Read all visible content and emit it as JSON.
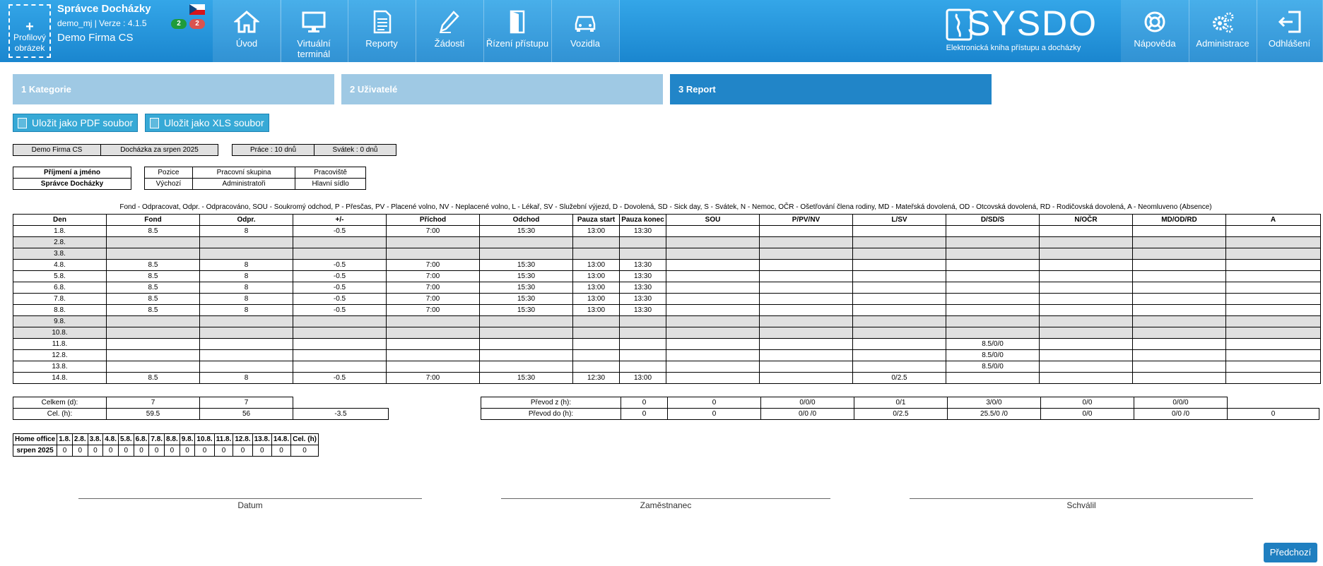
{
  "header": {
    "profile_label": "Profilový obrázek",
    "profile_plus": "+",
    "app_title": "Správce Docházky",
    "user_version": "demo_mj | Verze : 4.1.5",
    "company": "Demo Firma CS",
    "badge_green": "2",
    "badge_red": "2",
    "nav": [
      {
        "label": "Úvod",
        "icon": "home-icon"
      },
      {
        "label": "Virtuální terminál",
        "icon": "monitor-icon"
      },
      {
        "label": "Reporty",
        "icon": "document-icon"
      },
      {
        "label": "Žádosti",
        "icon": "pen-icon"
      },
      {
        "label": "Řízení přístupu",
        "icon": "door-icon"
      },
      {
        "label": "Vozidla",
        "icon": "car-icon"
      }
    ],
    "logo_name": "SYSDO",
    "logo_sub": "Elektronická kniha přístupu a docházky",
    "right_nav": [
      {
        "label": "Nápověda",
        "icon": "lifebuoy-icon"
      },
      {
        "label": "Administrace",
        "icon": "gears-icon"
      },
      {
        "label": "Odhlášení",
        "icon": "logout-icon"
      }
    ]
  },
  "steps": [
    "1 Kategorie",
    "2 Uživatelé",
    "3 Report"
  ],
  "buttons": {
    "pdf": "Uložit jako PDF soubor",
    "xls": "Uložit jako XLS soubor",
    "next": "Předchozí"
  },
  "info": {
    "company": "Demo Firma CS",
    "period": "Docházka za srpen 2025",
    "work": "Práce : 10 dnů",
    "holiday": "Svátek : 0 dnů"
  },
  "person": {
    "h_name": "Příjmení a jméno",
    "name": "Správce Docházky",
    "h_pos": "Pozice",
    "pos": "Výchozí",
    "h_group": "Pracovní skupina",
    "group": "Administratoři",
    "h_place": "Pracoviště",
    "place": "Hlavní sídlo"
  },
  "legend": "Fond - Odpracovat, Odpr. - Odpracováno, SOU - Soukromý odchod, P - Přesčas, PV - Placené volno, NV - Neplacené volno, L - Lékař, SV - Služební výjezd, D - Dovolená, SD - Sick day, S - Svátek, N - Nemoc, OČR - Ošetřování člena rodiny, MD - Mateřská dovolená, OD - Otcovská dovolená, RD - Rodičovská dovolená, A - Neomluveno (Absence)",
  "att_headers": [
    "Den",
    "Fond",
    "Odpr.",
    "+/-",
    "Příchod",
    "Odchod",
    "Pauza start",
    "Pauza konec",
    "SOU",
    "P/PV/NV",
    "L/SV",
    "D/SD/S",
    "N/OČR",
    "MD/OD/RD",
    "A"
  ],
  "att_rows": [
    {
      "cells": [
        "1.8.",
        "8.5",
        "8",
        "-0.5",
        "7:00",
        "15:30",
        "13:00",
        "13:30",
        "",
        "",
        "",
        "",
        "",
        "",
        ""
      ],
      "weekend": false
    },
    {
      "cells": [
        "2.8.",
        "",
        "",
        "",
        "",
        "",
        "",
        "",
        "",
        "",
        "",
        "",
        "",
        "",
        ""
      ],
      "weekend": true
    },
    {
      "cells": [
        "3.8.",
        "",
        "",
        "",
        "",
        "",
        "",
        "",
        "",
        "",
        "",
        "",
        "",
        "",
        ""
      ],
      "weekend": true
    },
    {
      "cells": [
        "4.8.",
        "8.5",
        "8",
        "-0.5",
        "7:00",
        "15:30",
        "13:00",
        "13:30",
        "",
        "",
        "",
        "",
        "",
        "",
        ""
      ],
      "weekend": false
    },
    {
      "cells": [
        "5.8.",
        "8.5",
        "8",
        "-0.5",
        "7:00",
        "15:30",
        "13:00",
        "13:30",
        "",
        "",
        "",
        "",
        "",
        "",
        ""
      ],
      "weekend": false
    },
    {
      "cells": [
        "6.8.",
        "8.5",
        "8",
        "-0.5",
        "7:00",
        "15:30",
        "13:00",
        "13:30",
        "",
        "",
        "",
        "",
        "",
        "",
        ""
      ],
      "weekend": false
    },
    {
      "cells": [
        "7.8.",
        "8.5",
        "8",
        "-0.5",
        "7:00",
        "15:30",
        "13:00",
        "13:30",
        "",
        "",
        "",
        "",
        "",
        "",
        ""
      ],
      "weekend": false
    },
    {
      "cells": [
        "8.8.",
        "8.5",
        "8",
        "-0.5",
        "7:00",
        "15:30",
        "13:00",
        "13:30",
        "",
        "",
        "",
        "",
        "",
        "",
        ""
      ],
      "weekend": false
    },
    {
      "cells": [
        "9.8.",
        "",
        "",
        "",
        "",
        "",
        "",
        "",
        "",
        "",
        "",
        "",
        "",
        "",
        ""
      ],
      "weekend": true
    },
    {
      "cells": [
        "10.8.",
        "",
        "",
        "",
        "",
        "",
        "",
        "",
        "",
        "",
        "",
        "",
        "",
        "",
        ""
      ],
      "weekend": true
    },
    {
      "cells": [
        "11.8.",
        "",
        "",
        "",
        "",
        "",
        "",
        "",
        "",
        "",
        "",
        "8.5/0/0",
        "",
        "",
        ""
      ],
      "weekend": false
    },
    {
      "cells": [
        "12.8.",
        "",
        "",
        "",
        "",
        "",
        "",
        "",
        "",
        "",
        "",
        "8.5/0/0",
        "",
        "",
        ""
      ],
      "weekend": false
    },
    {
      "cells": [
        "13.8.",
        "",
        "",
        "",
        "",
        "",
        "",
        "",
        "",
        "",
        "",
        "8.5/0/0",
        "",
        "",
        ""
      ],
      "weekend": false
    },
    {
      "cells": [
        "14.8.",
        "8.5",
        "8",
        "-0.5",
        "7:00",
        "15:30",
        "12:30",
        "13:00",
        "",
        "",
        "0/2.5",
        "",
        "",
        "",
        ""
      ],
      "weekend": false
    }
  ],
  "totals": [
    {
      "label": "Celkem (d):",
      "fond": "7",
      "odpr": "7",
      "diff": ""
    },
    {
      "label": "Cel. (h):",
      "fond": "59.5",
      "odpr": "56",
      "diff": "-3.5"
    }
  ],
  "transfers": [
    {
      "label": "Převod z (h):",
      "values": [
        "0",
        "0",
        "0/0/0",
        "0/1",
        "3/0/0",
        "0/0",
        "0/0/0"
      ]
    },
    {
      "label": "Převod do (h):",
      "values": [
        "0",
        "0",
        "0/0 /0",
        "0/2.5",
        "25.5/0 /0",
        "0/0",
        "0/0 /0",
        "0"
      ]
    }
  ],
  "home_office": {
    "headers": [
      "Home office",
      "1.8.",
      "2.8.",
      "3.8.",
      "4.8.",
      "5.8.",
      "6.8.",
      "7.8.",
      "8.8.",
      "9.8.",
      "10.8.",
      "11.8.",
      "12.8.",
      "13.8.",
      "14.8.",
      "Cel. (h)"
    ],
    "row": [
      "srpen 2025",
      "0",
      "0",
      "0",
      "0",
      "0",
      "0",
      "0",
      "0",
      "0",
      "0",
      "0",
      "0",
      "0",
      "0",
      "0"
    ]
  },
  "signatures": [
    "Datum",
    "Zaměstnanec",
    "Schválil"
  ]
}
